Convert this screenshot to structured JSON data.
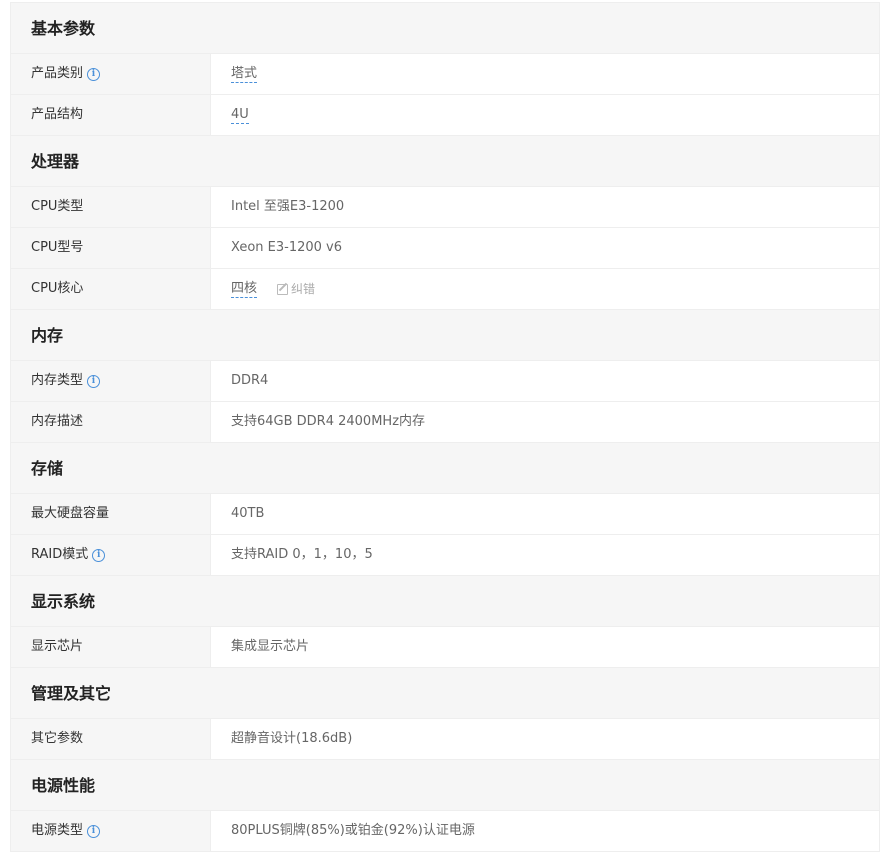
{
  "sections": [
    {
      "title": "基本参数",
      "rows": [
        {
          "key": "产品类别",
          "info": true,
          "value": "塔式",
          "dotted": true
        },
        {
          "key": "产品结构",
          "info": false,
          "value": "4U",
          "dotted": true
        }
      ]
    },
    {
      "title": "处理器",
      "rows": [
        {
          "key": "CPU类型",
          "info": false,
          "value": "Intel 至强E3-1200"
        },
        {
          "key": "CPU型号",
          "info": false,
          "value": "Xeon E3-1200 v6"
        },
        {
          "key": "CPU核心",
          "info": false,
          "value": "四核",
          "dotted": true,
          "correction": "纠错"
        }
      ]
    },
    {
      "title": "内存",
      "rows": [
        {
          "key": "内存类型",
          "info": true,
          "value": "DDR4"
        },
        {
          "key": "内存描述",
          "info": false,
          "value": "支持64GB DDR4 2400MHz内存"
        }
      ]
    },
    {
      "title": "存储",
      "rows": [
        {
          "key": "最大硬盘容量",
          "info": false,
          "value": "40TB"
        },
        {
          "key": "RAID模式",
          "info": true,
          "value": "支持RAID 0，1，10，5"
        }
      ]
    },
    {
      "title": "显示系统",
      "rows": [
        {
          "key": "显示芯片",
          "info": false,
          "value": "集成显示芯片"
        }
      ]
    },
    {
      "title": "管理及其它",
      "rows": [
        {
          "key": "其它参数",
          "info": false,
          "value": "超静音设计(18.6dB)"
        }
      ]
    },
    {
      "title": "电源性能",
      "rows": [
        {
          "key": "电源类型",
          "info": true,
          "value": "80PLUS铜牌(85%)或铂金(92%)认证电源"
        }
      ]
    }
  ],
  "info_symbol": "i",
  "accent_color": "#4a90d9"
}
